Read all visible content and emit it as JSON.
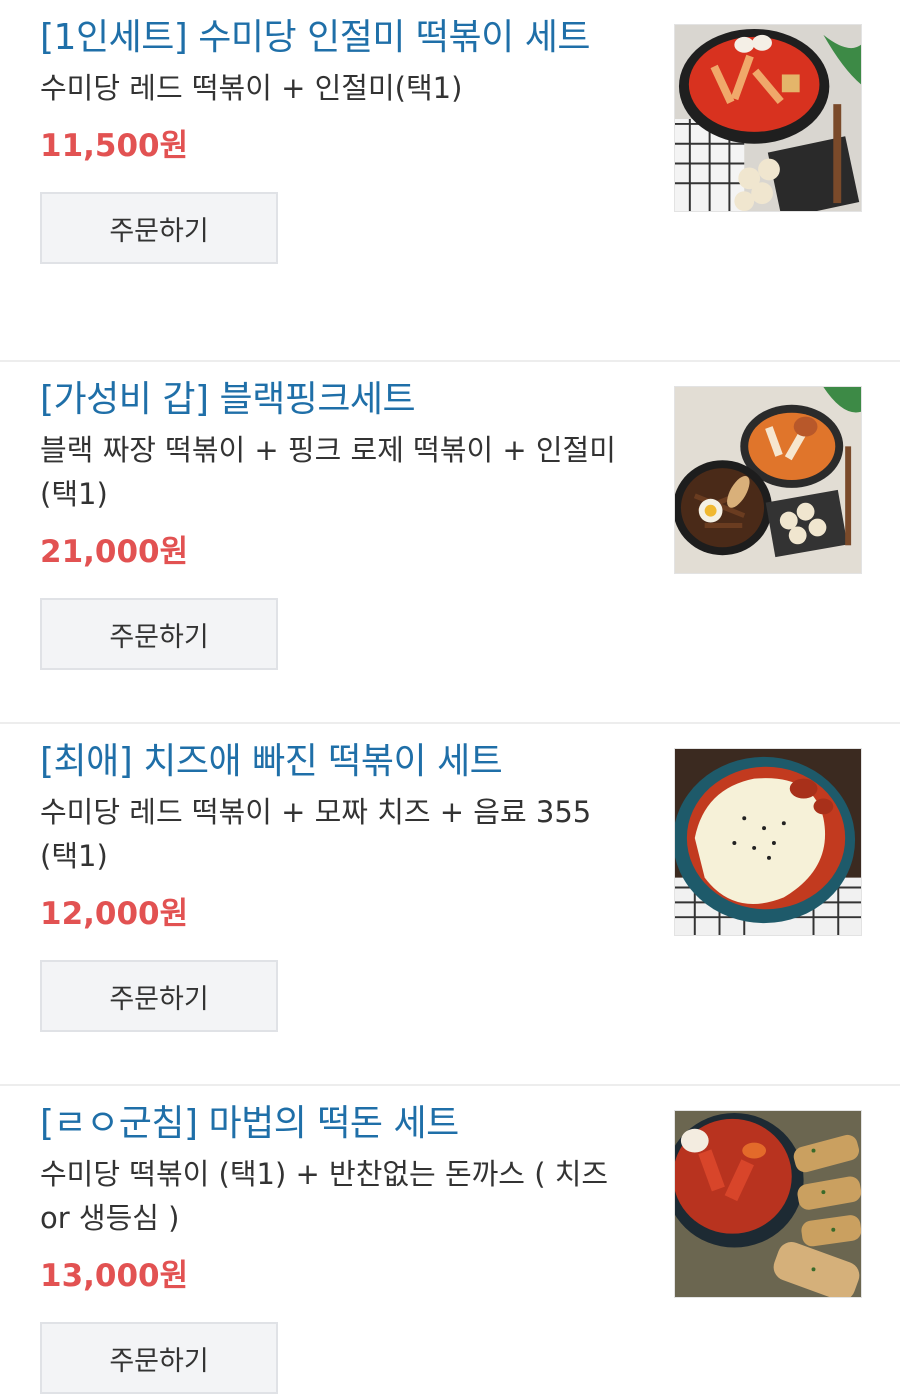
{
  "menu_items": [
    {
      "title": "[1인세트] 수미당 인절미 떡볶이 세트",
      "description": "수미당 레드 떡볶이 + 인절미(택1)",
      "price": "11,500원",
      "order_label": "주문하기",
      "image": "tteokbokki-set-photo"
    },
    {
      "title": "[가성비 갑] 블랙핑크세트",
      "description": "블랙 짜장 떡볶이 + 핑크 로제 떡볶이 + 인절미 (택1)",
      "price": "21,000원",
      "order_label": "주문하기",
      "image": "black-pink-set-photo"
    },
    {
      "title": "[최애] 치즈애 빠진 떡볶이 세트",
      "description": "수미당 레드 떡볶이 + 모짜 치즈 + 음료 355 (택1)",
      "price": "12,000원",
      "order_label": "주문하기",
      "image": "cheese-tteokbokki-photo"
    },
    {
      "title": "[ㄹㅇ군침] 마법의 떡돈 세트",
      "description": "수미당 떡볶이 (택1) + 반찬없는 돈까스 ( 치즈 or 생등심 )",
      "price": "13,000원",
      "order_label": "주문하기",
      "image": "tteokbokki-tonkatsu-photo"
    }
  ],
  "colors": {
    "title": "#1f6fa8",
    "price": "#e25252",
    "button_bg": "#f3f4f6"
  }
}
